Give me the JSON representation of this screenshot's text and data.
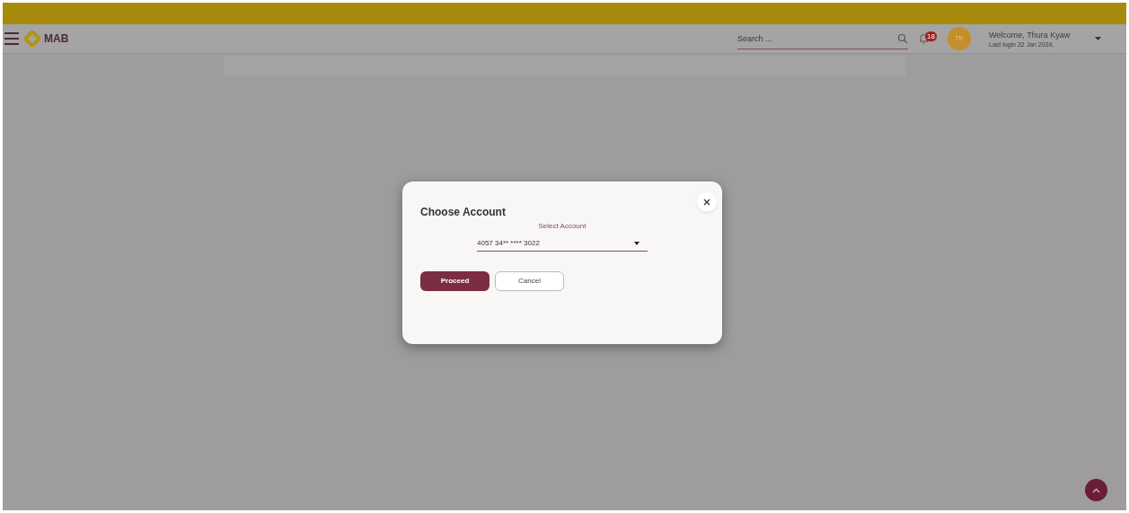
{
  "header": {
    "logo_text": "MAB",
    "search": {
      "placeholder": "Search ..."
    },
    "notifications": {
      "count": "18"
    },
    "avatar": {
      "initials": "TK"
    },
    "welcome": "Welcome, Thura Kyaw",
    "last_login": "Last login 22 Jan 2024,"
  },
  "dialog": {
    "title": "Choose Account",
    "field": {
      "label": "Select Account",
      "value": "4057 34** **** 3022"
    },
    "buttons": [
      {
        "label": "Proceed",
        "kind": "primary"
      },
      {
        "label": "Cancel",
        "kind": "secondary"
      }
    ]
  }
}
